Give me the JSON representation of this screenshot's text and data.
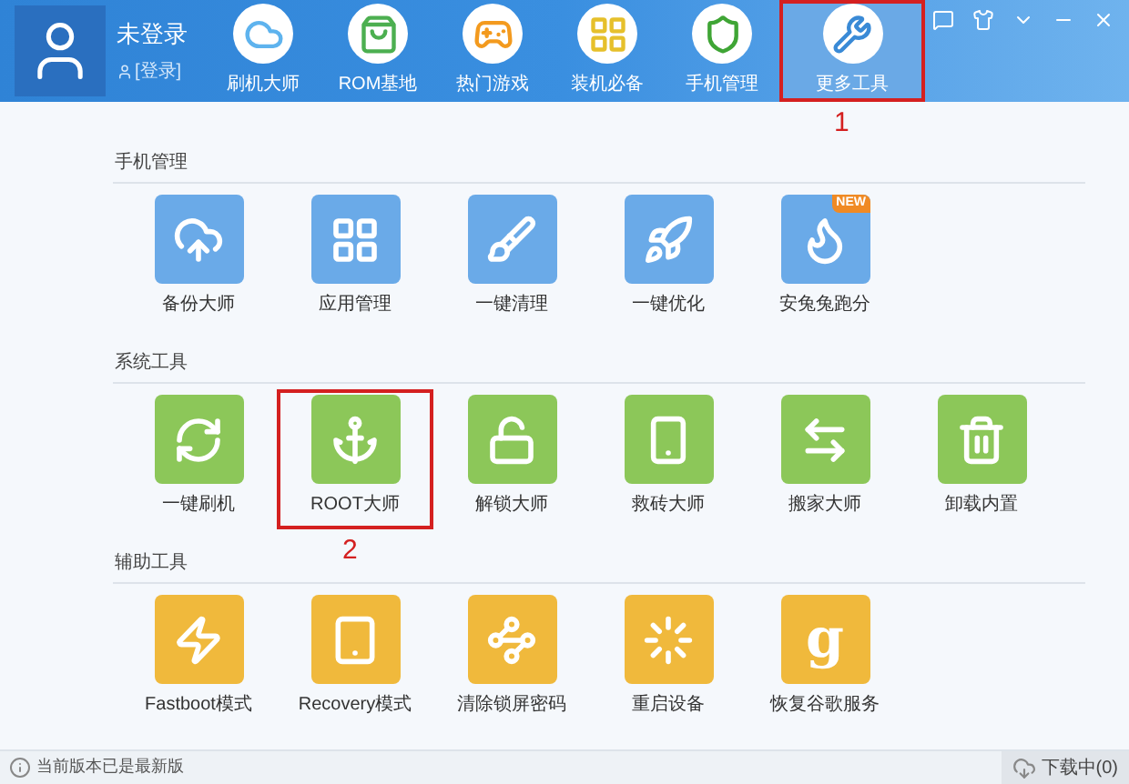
{
  "user": {
    "name": "未登录",
    "login": "[登录]"
  },
  "nav": [
    {
      "label": "刷机大师",
      "selected": false
    },
    {
      "label": "ROM基地",
      "selected": false
    },
    {
      "label": "热门游戏",
      "selected": false
    },
    {
      "label": "装机必备",
      "selected": false
    },
    {
      "label": "手机管理",
      "selected": false
    },
    {
      "label": "更多工具",
      "selected": true,
      "annotation": "1"
    }
  ],
  "sections": [
    {
      "title": "手机管理",
      "color": "#6aaae8",
      "items": [
        {
          "label": "备份大师"
        },
        {
          "label": "应用管理"
        },
        {
          "label": "一键清理"
        },
        {
          "label": "一键优化"
        },
        {
          "label": "安兔兔跑分",
          "badge": "NEW"
        }
      ]
    },
    {
      "title": "系统工具",
      "color": "#8cc759",
      "items": [
        {
          "label": "一键刷机"
        },
        {
          "label": "ROOT大师",
          "annotation": "2"
        },
        {
          "label": "解锁大师"
        },
        {
          "label": "救砖大师"
        },
        {
          "label": "搬家大师"
        },
        {
          "label": "卸载内置"
        }
      ]
    },
    {
      "title": "辅助工具",
      "color": "#f0b93c",
      "items": [
        {
          "label": "Fastboot模式"
        },
        {
          "label": "Recovery模式"
        },
        {
          "label": "清除锁屏密码"
        },
        {
          "label": "重启设备"
        },
        {
          "label": "恢复谷歌服务",
          "glyph": "g"
        }
      ]
    }
  ],
  "status_bar": {
    "message": "当前版本已是最新版",
    "downloads": "下载中(0)"
  }
}
